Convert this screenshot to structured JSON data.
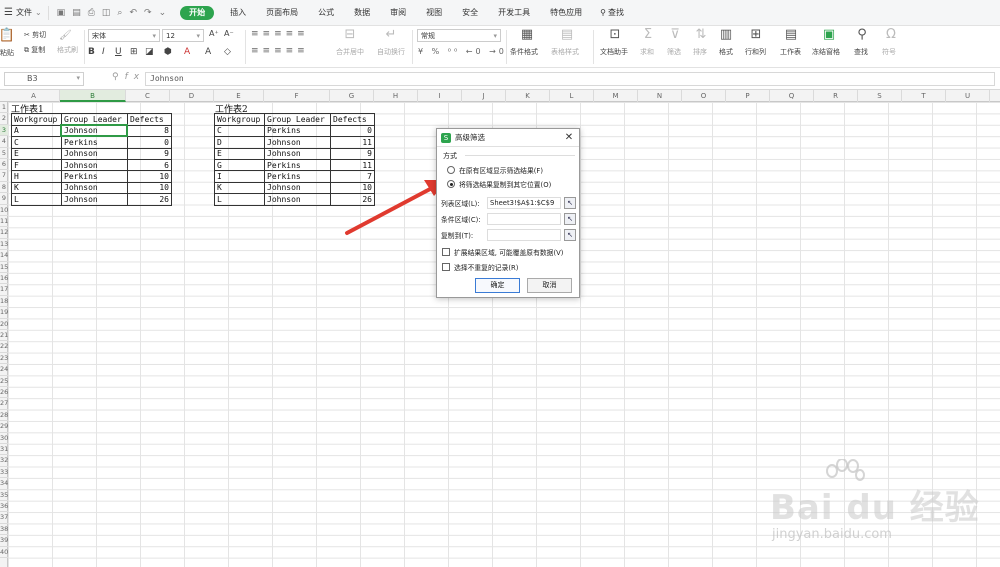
{
  "menubar": {
    "file_label": "文件",
    "tabs": [
      "开始",
      "插入",
      "页面布局",
      "公式",
      "数据",
      "审阅",
      "视图",
      "安全",
      "开发工具",
      "特色应用"
    ],
    "search_label": "查找"
  },
  "ribbon": {
    "paste_label": "粘贴",
    "cut_label": "剪切",
    "copy_label": "复制",
    "format_painter_label": "格式刷",
    "font_name": "宋体",
    "font_size": "12",
    "merge_center_label": "合并居中",
    "wrap_text_label": "自动换行",
    "number_format": "常规",
    "conditional_format_label": "条件格式",
    "table_style_label": "表格样式",
    "doc_assistant_label": "文档助手",
    "sum_label": "求和",
    "filter_label": "筛选",
    "sort_label": "排序",
    "format_label": "格式",
    "row_col_label": "行和列",
    "worksheet_label": "工作表",
    "freeze_label": "冻结窗格",
    "find_label": "查找",
    "symbol_label": "符号"
  },
  "formula_bar": {
    "cell_ref": "B3",
    "fx_label": "fx",
    "content": "Johnson"
  },
  "grid": {
    "columns": [
      "A",
      "B",
      "C",
      "D",
      "E",
      "F",
      "G",
      "H",
      "I",
      "J",
      "K",
      "L",
      "M",
      "N",
      "O",
      "P",
      "Q",
      "R",
      "S",
      "T",
      "U"
    ],
    "rows": [
      "1",
      "2",
      "3",
      "4",
      "5",
      "6",
      "7",
      "8",
      "9",
      "10",
      "11",
      "12",
      "13",
      "14",
      "15",
      "16",
      "17",
      "18",
      "19",
      "20",
      "21",
      "22",
      "23",
      "24",
      "25",
      "26",
      "27",
      "28",
      "29",
      "30",
      "31",
      "32",
      "33",
      "34",
      "35",
      "36",
      "37",
      "38",
      "39",
      "40"
    ],
    "selected_column": "B",
    "selected_row": "3"
  },
  "table1": {
    "title": "工作表1",
    "headers": [
      "Workgroup",
      "Group Leader",
      "Defects"
    ],
    "rows": [
      [
        "A",
        "Johnson",
        "8"
      ],
      [
        "C",
        "Perkins",
        "0"
      ],
      [
        "E",
        "Johnson",
        "9"
      ],
      [
        "F",
        "Johnson",
        "6"
      ],
      [
        "H",
        "Perkins",
        "10"
      ],
      [
        "K",
        "Johnson",
        "10"
      ],
      [
        "L",
        "Johnson",
        "26"
      ]
    ]
  },
  "table2": {
    "title": "工作表2",
    "headers": [
      "Workgroup",
      "Group Leader",
      "Defects"
    ],
    "rows": [
      [
        "C",
        "Perkins",
        "0"
      ],
      [
        "D",
        "Johnson",
        "11"
      ],
      [
        "E",
        "Johnson",
        "9"
      ],
      [
        "G",
        "Perkins",
        "11"
      ],
      [
        "I",
        "Perkins",
        "7"
      ],
      [
        "K",
        "Johnson",
        "10"
      ],
      [
        "L",
        "Johnson",
        "26"
      ]
    ]
  },
  "dialog": {
    "title": "高级筛选",
    "close_label": "✕",
    "app_icon_label": "S",
    "group_label": "方式",
    "option1": "在原有区域显示筛选结果(F)",
    "option2": "将筛选结果复制到其它位置(O)",
    "list_range_label": "列表区域(L):",
    "list_range_value": "Sheet3!$A$1:$C$9",
    "criteria_label": "条件区域(C):",
    "criteria_value": "",
    "copy_to_label": "复制到(T):",
    "copy_to_value": "",
    "expand_label": "扩展结果区域, 可能覆盖原有数据(V)",
    "unique_label": "选择不重复的记录(R)",
    "ok_label": "确定",
    "cancel_label": "取消"
  },
  "watermark": {
    "brand": "Bai  du 经验",
    "url": "jingyan.baidu.com"
  },
  "colors": {
    "accent_green": "#2da44e",
    "arrow_red": "#e03a2f",
    "selection_green": "#2f9a46"
  }
}
